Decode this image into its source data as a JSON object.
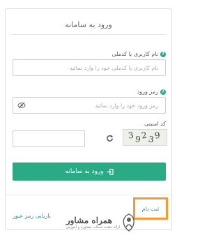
{
  "form": {
    "title": "ورود به سامانه",
    "username_label": "نام کاربری یا کدملی",
    "username_placeholder": "نام کاربری یا کدملی خود را وارد نمائید",
    "password_label": "رمز ورود",
    "password_placeholder": "رمز ورود خود را وارد نمائید",
    "captcha_label": "کد امنیتی",
    "captcha_chars": [
      "3",
      "9",
      "2",
      "3",
      "9"
    ],
    "login_button": "ورود به سامانه",
    "forgot_password": "بازیابی رمز عبور",
    "register": "ثبت نام"
  },
  "watermark": {
    "title": "همراه مشاور",
    "subtitle": "ارائه دهنده خدمات مشاوره و آموزش"
  },
  "colors": {
    "accent": "#2baa86",
    "link": "#2a8f9c",
    "highlight_border": "#f39a3a"
  }
}
